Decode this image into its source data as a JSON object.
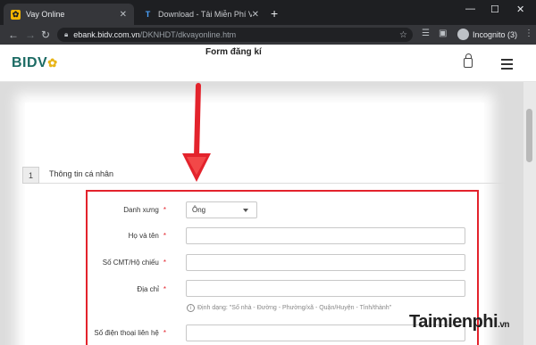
{
  "browser": {
    "tabs": [
      {
        "title": "Vay Online",
        "active": true
      },
      {
        "title": "Download - Tải Miễn Phí VN - Ph",
        "active": false
      }
    ],
    "favicon_letter": "T",
    "close_glyph": "✕",
    "new_tab_glyph": "+",
    "window_controls": {
      "minimize": "—",
      "maximize": "☐",
      "close": "✕"
    },
    "nav": {
      "back": "←",
      "forward": "→",
      "reload": "↻"
    },
    "url_host": "ebank.bidv.com.vn",
    "url_path": "/DKNHDT/dkvayonline.htm",
    "incognito_label": "Incognito (3)",
    "more_glyph": "⋮"
  },
  "site": {
    "logo_text": "BIDV",
    "logo_mark": "✿"
  },
  "form": {
    "title": "Form đăng kí",
    "section_number": "1",
    "section_title": "Thông tin cá nhân",
    "required_mark": "*",
    "fields": {
      "salutation_label": "Danh xưng",
      "salutation_value": "Ông",
      "fullname_label": "Họ và tên",
      "id_label": "Số CMT/Hộ chiếu",
      "address_label": "Địa chỉ",
      "address_hint": "Định dạng: \"Số nhà - Đường - Phường/xã - Quận/Huyện - Tỉnh/thành\"",
      "phone_label": "Số điện thoại liên hệ"
    }
  },
  "watermark": {
    "brand": "Taimienphi",
    "tld": ".vn"
  },
  "colors": {
    "highlight_red": "#e3232c",
    "bidv_green": "#1c6b64",
    "bidv_gold": "#e8b417"
  },
  "icons": [
    "lock-icon",
    "star-icon",
    "sidebar-icon",
    "extensions-icon",
    "menu-icon",
    "info-icon",
    "chevron-down-icon",
    "down-arrow-annotation"
  ]
}
